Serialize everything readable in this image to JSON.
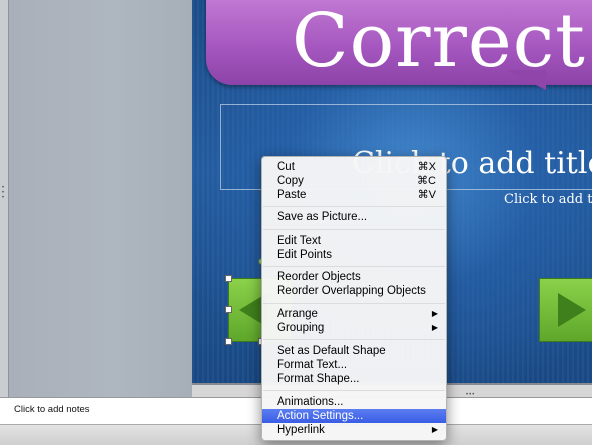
{
  "slide": {
    "banner_text": "Correct!",
    "title_placeholder": "Click to add title",
    "subtitle_placeholder": "Click to add text"
  },
  "notes": {
    "placeholder": "Click to add notes"
  },
  "context_menu": {
    "items": [
      {
        "label": "Cut",
        "shortcut": "⌘X"
      },
      {
        "label": "Copy",
        "shortcut": "⌘C"
      },
      {
        "label": "Paste",
        "shortcut": "⌘V"
      },
      {
        "label": "Save as Picture..."
      },
      {
        "label": "Edit Text"
      },
      {
        "label": "Edit Points"
      },
      {
        "label": "Reorder Objects"
      },
      {
        "label": "Reorder Overlapping Objects"
      },
      {
        "label": "Arrange",
        "submenu": "▶"
      },
      {
        "label": "Grouping",
        "submenu": "▶"
      },
      {
        "label": "Set as Default Shape"
      },
      {
        "label": "Format Text..."
      },
      {
        "label": "Format Shape..."
      },
      {
        "label": "Animations..."
      },
      {
        "label": "Action Settings...",
        "highlighted": true
      },
      {
        "label": "Hyperlink",
        "submenu": "▶"
      }
    ]
  },
  "colors": {
    "banner": "#a557bf",
    "slide_bg": "#235c9f",
    "arrow_button": "#6db534",
    "menu_highlight": "#3a5de6"
  }
}
